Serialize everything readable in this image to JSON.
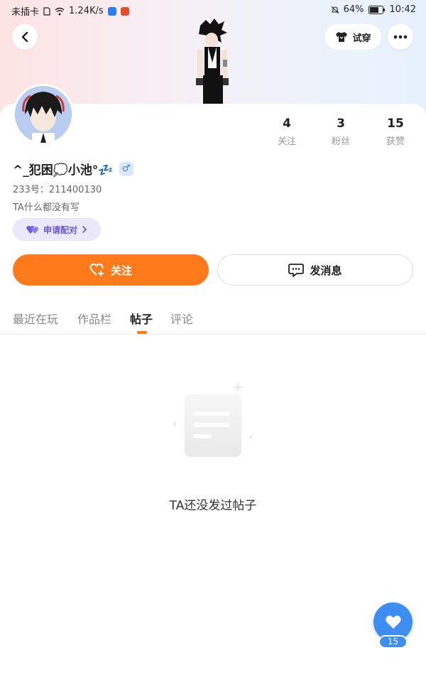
{
  "status_bar": {
    "carrier": "未插卡",
    "speed": "1.24K/s",
    "battery": "64%",
    "time": "10:42"
  },
  "header": {
    "try_on_label": "试穿",
    "icons": [
      "back-arrow-icon",
      "tshirt-icon",
      "more-icon"
    ]
  },
  "profile": {
    "name": "^_犯困💭小池°💤",
    "gender": "♂",
    "uid": "233号：211400130",
    "bio": "TA什么都没有写",
    "pair_label": "申请配对"
  },
  "stats": [
    {
      "value": "4",
      "label": "关注"
    },
    {
      "value": "3",
      "label": "粉丝"
    },
    {
      "value": "15",
      "label": "获赞"
    }
  ],
  "actions": {
    "follow_label": "关注",
    "message_label": "发消息"
  },
  "tabs": [
    {
      "label": "最近在玩",
      "active": false
    },
    {
      "label": "作品栏",
      "active": false
    },
    {
      "label": "帖子",
      "active": true
    },
    {
      "label": "评论",
      "active": false
    }
  ],
  "empty_state": {
    "text": "TA还没发过帖子"
  },
  "like_fab": {
    "count": "15"
  },
  "colors": {
    "accent": "#ff7a1a",
    "fab": "#3d8ef0",
    "pair": "#6a5bd8"
  }
}
